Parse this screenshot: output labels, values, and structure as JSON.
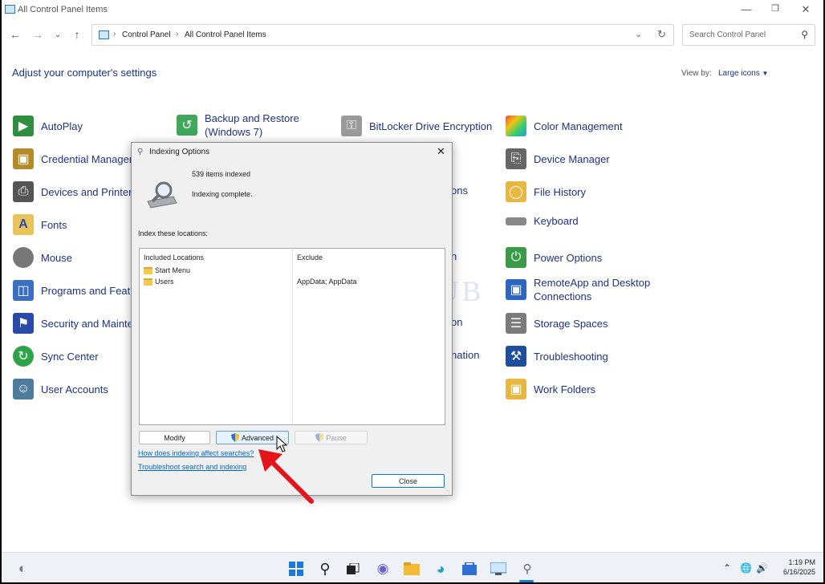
{
  "window": {
    "title": "All Control Panel Items",
    "min_icon": "minimize-icon",
    "max_icon": "maximize-icon",
    "close_icon": "close-icon"
  },
  "address": {
    "crumbs": [
      "Control Panel",
      "All Control Panel Items"
    ]
  },
  "search": {
    "placeholder": "Search Control Panel"
  },
  "heading": "Adjust your computer's settings",
  "view_by": {
    "label": "View by:",
    "value": "Large icons"
  },
  "items": {
    "col1": [
      "AutoPlay",
      "Credential Manager",
      "Devices and Printers",
      "Fonts",
      "Mouse",
      "Programs and Features",
      "Security and Maintenance",
      "Sync Center",
      "User Accounts"
    ],
    "col2_first": [
      "Backup and Restore",
      "(Windows 7)"
    ],
    "col3_first": "BitLocker Drive Encryption",
    "col3_partial": [
      "ons",
      "n",
      "on",
      "nation"
    ],
    "col4": [
      "Color Management",
      "Device Manager",
      "File History",
      "Keyboard",
      "Power Options",
      "RemoteApp and Desktop",
      "Connections",
      "Storage Spaces",
      "Troubleshooting",
      "Work Folders"
    ]
  },
  "watermark": "IT Pros HUB",
  "dialog": {
    "title": "Indexing Options",
    "items_indexed": "539 items indexed",
    "status": "Indexing complete.",
    "index_label": "Index these locations:",
    "col_included": "Included Locations",
    "col_exclude": "Exclude",
    "rows": [
      {
        "location": "Start Menu",
        "exclude": ""
      },
      {
        "location": "Users",
        "exclude": "AppData; AppData"
      }
    ],
    "buttons": {
      "modify": "Modify",
      "advanced": "Advanced",
      "pause": "Pause",
      "close": "Close"
    },
    "links": {
      "how": "How does indexing affect searches?",
      "troubleshoot": "Troubleshoot search and indexing"
    }
  },
  "taskbar": {
    "time": "1:19 PM",
    "date": "6/16/2025"
  },
  "colors": {
    "link": "#0066cc",
    "heading": "#1e3287",
    "arrow": "#e3151a"
  }
}
